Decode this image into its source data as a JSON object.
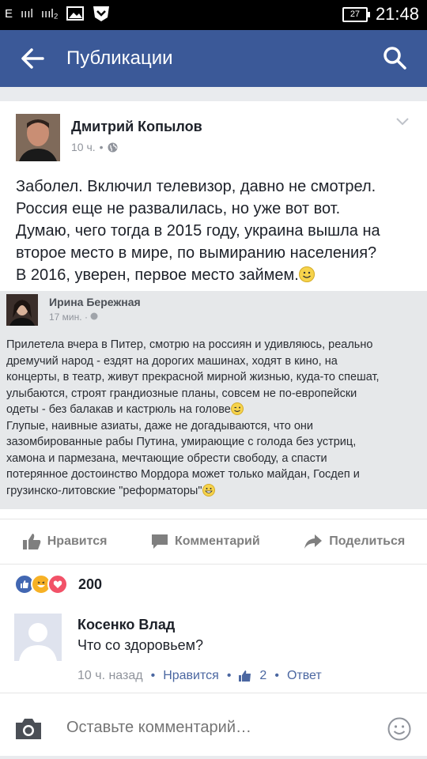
{
  "status_bar": {
    "network_label": "E",
    "sim1_bars": "ıııl",
    "sim2_bars": "ıııl₂",
    "battery": "27",
    "time": "21:48"
  },
  "app_bar": {
    "title": "Публикации",
    "back_icon": "arrow-left-icon",
    "search_icon": "search-icon"
  },
  "post": {
    "author": "Дмитрий Копылов",
    "time": "10 ч.",
    "privacy_icon": "globe-icon",
    "text_lines": [
      "Заболел. Включил телевизор, давно не смотрел.",
      "Россия еще не развалилась, но уже вот вот.",
      "Думаю, чего тогда в 2015 году, украина вышла на",
      "второе место в мире, по вымиранию населения?",
      " В 2016, уверен, первое место займем."
    ],
    "embedded": {
      "author": "Ирина Бережная",
      "time": "17 мин.",
      "text_lines": [
        "Прилетела вчера в Питер, смотрю на россиян и удивляюсь, реально",
        "дремучий народ - ездят на дорогих машинах, ходят в кино, на",
        "концерты, в театр, живут прекрасной мирной жизнью, куда-то спешат,",
        "улыбаются, строят грандиозные планы, совсем не по-европейски",
        "одеты - без балакав и кастрюль на голове",
        "Глупые, наивные азиаты, даже не догадываются, что они",
        "зазомбированные рабы Путина, умирающие с голода без устриц,",
        "хамона и пармезана, мечтающие обрести свободу, а спасти",
        "потерянное достоинство Мордора может только майдан, Госдеп и",
        "грузинско-литовские \"реформаторы\""
      ]
    },
    "actions": {
      "like": "Нравится",
      "comment": "Комментарий",
      "share": "Поделиться"
    },
    "reactions_count": "200",
    "colors": {
      "brand": "#3b5998",
      "like_blue": "#4b67a1"
    }
  },
  "comment": {
    "author": "Косенко Влад",
    "text": "Что со здоровьем?",
    "time": "10 ч. назад",
    "like_label": "Нравится",
    "likes": "2",
    "reply_label": "Ответ"
  },
  "composer": {
    "placeholder": "Оставьте комментарий…"
  }
}
